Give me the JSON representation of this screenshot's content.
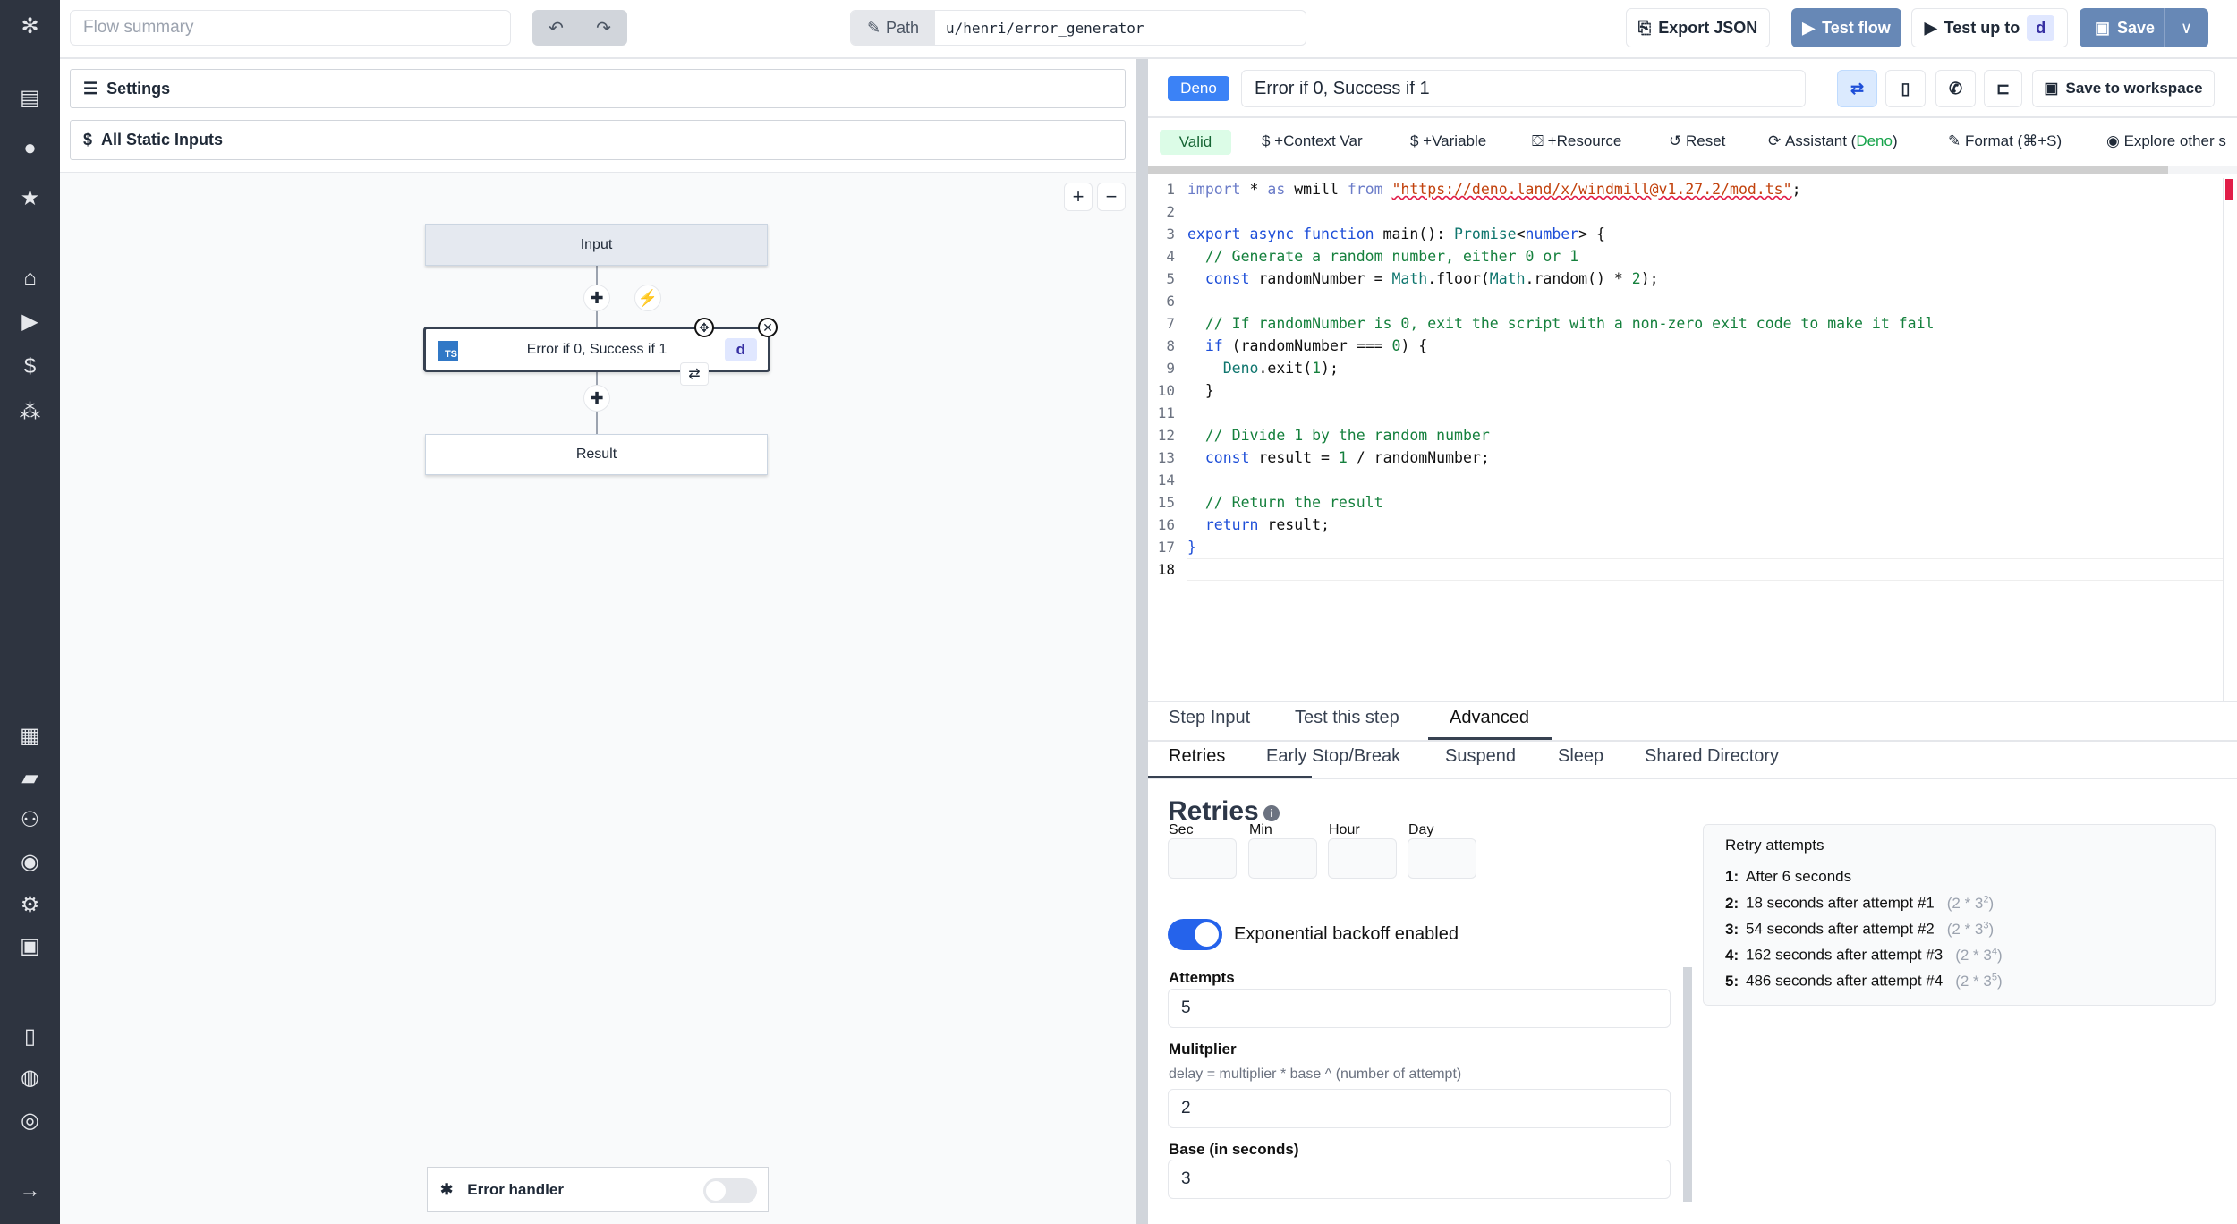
{
  "header": {
    "flow_summary_placeholder": "Flow summary",
    "path_label": "Path",
    "path_value": "u/henri/error_generator",
    "export_json": "Export JSON",
    "test_flow": "Test flow",
    "test_up_to": "Test up to",
    "test_up_to_badge": "d",
    "save": "Save"
  },
  "sidebar": {
    "icons": [
      "windmill-logo-icon",
      "dashboard-icon",
      "user-icon",
      "star-icon",
      "home-icon",
      "play-icon",
      "dollar-icon",
      "resources-icon",
      "calendar-icon",
      "folder-icon",
      "groups-icon",
      "eye-icon",
      "gear-icon",
      "robot-icon",
      "book-icon",
      "discord-icon",
      "github-icon",
      "expand-arrow-icon"
    ]
  },
  "left": {
    "settings": "Settings",
    "static_inputs": "All Static Inputs",
    "zoom_in": "+",
    "zoom_out": "−",
    "graph": {
      "input": "Input",
      "step": "Error if 0, Success if 1",
      "step_lang": "TS",
      "step_id": "d",
      "result": "Result"
    },
    "error_handler": "Error handler",
    "error_handler_enabled": false
  },
  "editor": {
    "lang_badge": "Deno",
    "title": "Error if 0, Success if 1",
    "save_workspace": "Save to workspace",
    "toolbar": {
      "valid": "Valid",
      "context_var": "$ +Context Var",
      "variable": "$ +Variable",
      "resource": "+Resource",
      "reset": "Reset",
      "assistant": "Assistant (",
      "assistant_lang": "Deno",
      "assistant_close": ")",
      "format": "Format (⌘+S)",
      "explore": "Explore other s"
    },
    "code": [
      [
        [
          "kwl",
          "import"
        ],
        [
          "pl",
          " * "
        ],
        [
          "kwl",
          "as"
        ],
        [
          "pl",
          " wmill "
        ],
        [
          "kwl",
          "from"
        ],
        [
          "pl",
          " "
        ],
        [
          "st",
          "\"https://deno.land/x/windmill@v1.27.2/mod.ts\""
        ],
        [
          "pl",
          ";"
        ]
      ],
      [],
      [
        [
          "kw",
          "export async function"
        ],
        [
          "pl",
          " main(): "
        ],
        [
          "ty",
          "Promise"
        ],
        [
          "pl",
          "<"
        ],
        [
          "kw",
          "number"
        ],
        [
          "pl",
          "> {"
        ]
      ],
      [
        [
          "cm",
          "  // Generate a random number, either 0 or 1"
        ]
      ],
      [
        [
          "kw",
          "  const"
        ],
        [
          "pl",
          " randomNumber = "
        ],
        [
          "ty",
          "Math"
        ],
        [
          "pl",
          ".floor("
        ],
        [
          "ty",
          "Math"
        ],
        [
          "pl",
          ".random() * "
        ],
        [
          "nu",
          "2"
        ],
        [
          "pl",
          ");"
        ]
      ],
      [],
      [
        [
          "cm",
          "  // If randomNumber is 0, exit the script with a non-zero exit code to make it fail"
        ]
      ],
      [
        [
          "kw",
          "  if"
        ],
        [
          "pl",
          " (randomNumber === "
        ],
        [
          "nu",
          "0"
        ],
        [
          "pl",
          ") {"
        ]
      ],
      [
        [
          "ty",
          "    Deno"
        ],
        [
          "pl",
          ".exit("
        ],
        [
          "nu",
          "1"
        ],
        [
          "pl",
          ");"
        ]
      ],
      [
        [
          "pl",
          "  }"
        ]
      ],
      [],
      [
        [
          "cm",
          "  // Divide 1 by the random number"
        ]
      ],
      [
        [
          "kw",
          "  const"
        ],
        [
          "pl",
          " result = "
        ],
        [
          "nu",
          "1"
        ],
        [
          "pl",
          " / randomNumber;"
        ]
      ],
      [],
      [
        [
          "cm",
          "  // Return the result"
        ]
      ],
      [
        [
          "kw",
          "  return"
        ],
        [
          "pl",
          " result;"
        ]
      ],
      [
        [
          "kw",
          "}"
        ]
      ],
      []
    ]
  },
  "bottom": {
    "tabs": [
      "Step Input",
      "Test this step",
      "Advanced"
    ],
    "active_tab": "Advanced",
    "subtabs": [
      "Retries",
      "Early Stop/Break",
      "Suspend",
      "Sleep",
      "Shared Directory"
    ],
    "active_subtab": "Retries",
    "retries_title": "Retries",
    "units": [
      "Sec",
      "Min",
      "Hour",
      "Day"
    ],
    "backoff_label": "Exponential backoff enabled",
    "backoff_enabled": true,
    "attempts_label": "Attempts",
    "attempts": "5",
    "multiplier_label": "Mulitplier",
    "multiplier_help": "delay = multiplier * base ^ (number of attempt)",
    "multiplier": "2",
    "base_label": "Base (in seconds)",
    "base": "3",
    "retry_box": {
      "title": "Retry attempts",
      "items": [
        {
          "n": "1:",
          "text": "After 6 seconds",
          "formula": ""
        },
        {
          "n": "2:",
          "text": "18 seconds after attempt #1",
          "formula": "(2 * 3",
          "exp": "2"
        },
        {
          "n": "3:",
          "text": "54 seconds after attempt #2",
          "formula": "(2 * 3",
          "exp": "3"
        },
        {
          "n": "4:",
          "text": "162 seconds after attempt #3",
          "formula": "(2 * 3",
          "exp": "4"
        },
        {
          "n": "5:",
          "text": "486 seconds after attempt #4",
          "formula": "(2 * 3",
          "exp": "5"
        }
      ]
    }
  },
  "colors": {
    "accent": "#3b82f6",
    "sidebar": "#2e3440",
    "valid_bg": "#dcfce7"
  }
}
